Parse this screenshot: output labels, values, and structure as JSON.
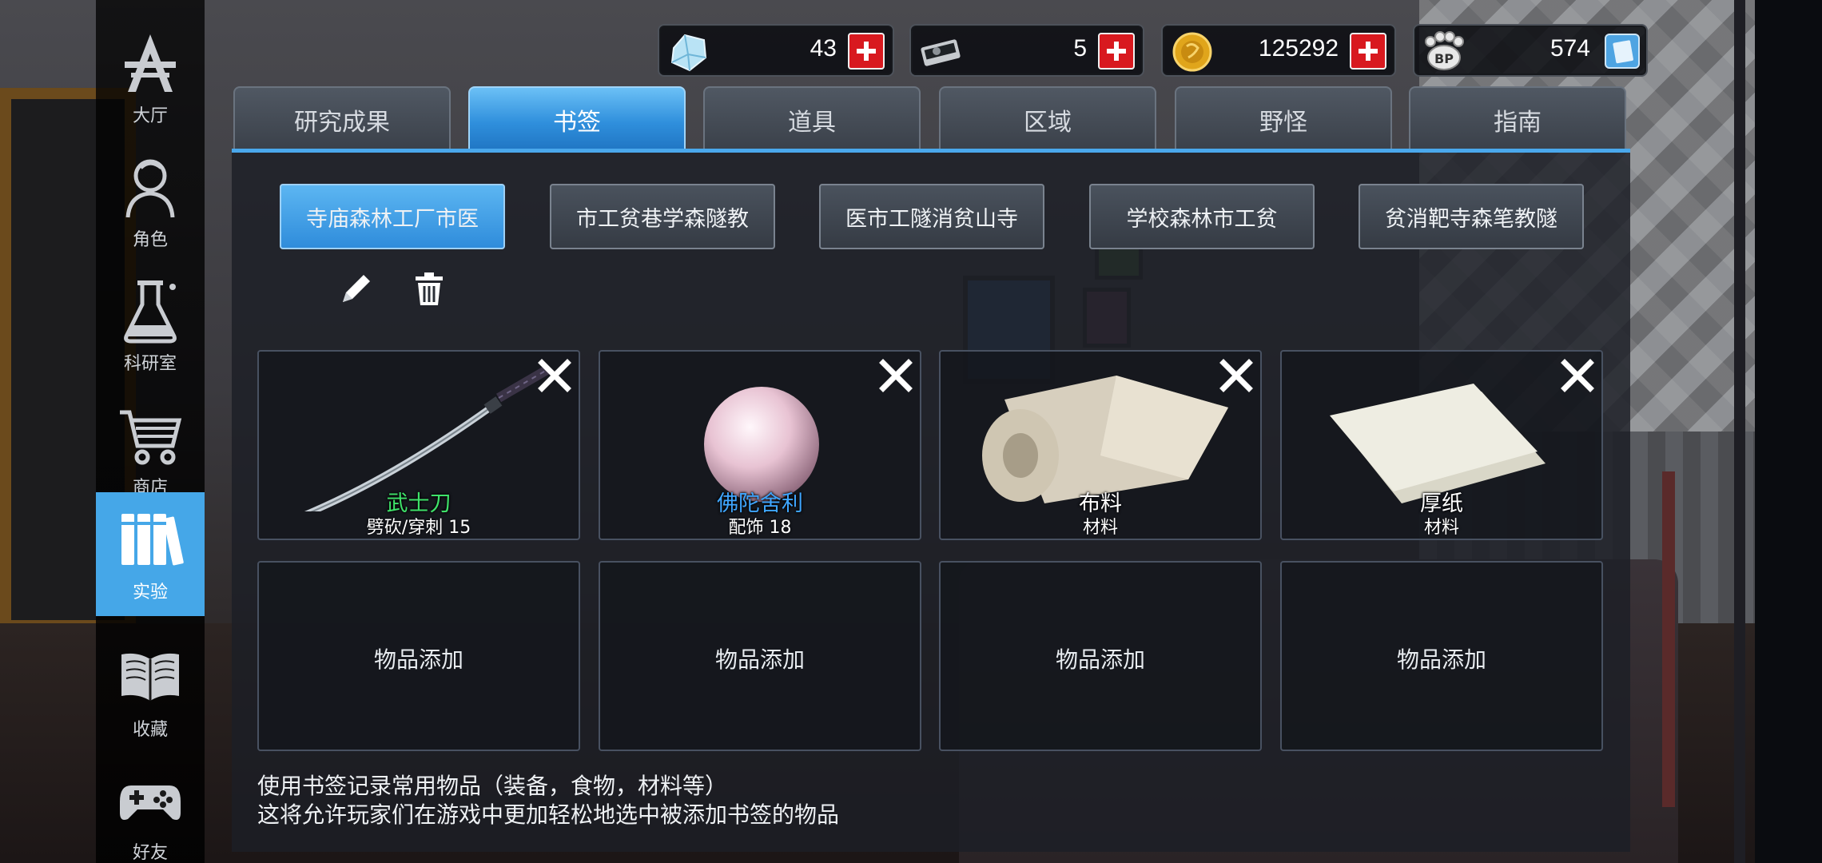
{
  "currencies": [
    {
      "icon": "crystal-icon",
      "value": "43"
    },
    {
      "icon": "hard-drive-icon",
      "value": "5"
    },
    {
      "icon": "gold-coin-icon",
      "value": "125292"
    },
    {
      "icon": "bp-paw-icon",
      "value": "574"
    }
  ],
  "sidebar": {
    "items": [
      {
        "label": "大厅",
        "icon": "lobby-icon"
      },
      {
        "label": "角色",
        "icon": "character-icon"
      },
      {
        "label": "科研室",
        "icon": "flask-icon"
      },
      {
        "label": "商店",
        "icon": "cart-icon"
      },
      {
        "label": "实验",
        "icon": "books-icon",
        "active": true
      },
      {
        "label": "收藏",
        "icon": "open-book-icon"
      },
      {
        "label": "好友",
        "icon": "gamepad-icon"
      }
    ]
  },
  "tabs": [
    {
      "label": "研究成果"
    },
    {
      "label": "书签",
      "active": true
    },
    {
      "label": "道具"
    },
    {
      "label": "区域"
    },
    {
      "label": "野怪"
    },
    {
      "label": "指南"
    }
  ],
  "bookmark_tabs": [
    {
      "label": "寺庙森林工厂市医",
      "active": true
    },
    {
      "label": "市工贫巷学森隧教"
    },
    {
      "label": "医市工隧消贫山寺"
    },
    {
      "label": "学校森林市工贫"
    },
    {
      "label": "贫消靶寺森笔教隧"
    }
  ],
  "items": [
    {
      "name": "武士刀",
      "sub": "劈砍/穿刺 15",
      "name_color": "#3fe26a",
      "icon": "katana-icon"
    },
    {
      "name": "佛陀舍利",
      "sub": "配饰 18",
      "name_color": "#3fa6ff",
      "icon": "pearl-icon"
    },
    {
      "name": "布料",
      "sub": "材料",
      "name_color": "#ffffff",
      "icon": "cloth-roll-icon"
    },
    {
      "name": "厚纸",
      "sub": "材料",
      "name_color": "#ffffff",
      "icon": "paper-icon"
    }
  ],
  "empty_slot_label": "物品添加",
  "footer": {
    "line1": "使用书签记录常用物品（装备，食物，材料等）",
    "line2": "这将允许玩家们在游戏中更加轻松地选中被添加书签的物品"
  },
  "colors": {
    "accent": "#45a7e8",
    "plus_red": "#d8191f"
  }
}
